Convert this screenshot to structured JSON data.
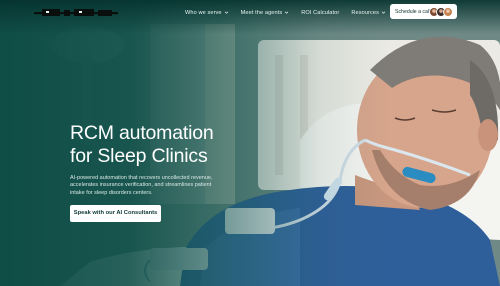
{
  "nav": {
    "links": [
      {
        "label": "Who we serve",
        "has_dropdown": true
      },
      {
        "label": "Meet the agents",
        "has_dropdown": true
      },
      {
        "label": "ROI Calculator",
        "has_dropdown": false
      },
      {
        "label": "Resources",
        "has_dropdown": true
      }
    ],
    "cta_label": "Schedule a call"
  },
  "hero": {
    "title_line1": "RCM automation",
    "title_line2": "for Sleep Clinics",
    "subtitle": "AI-powered automation that recovers uncollected revenue, accelerates insurance verification, and streamlines patient intake for sleep disorders centers.",
    "button_label": "Speak with our AI Consultants"
  },
  "colors": {
    "brand_teal": "#0b4a44",
    "cta_background": "#ffffff",
    "cta_text": "#0d2f2b"
  },
  "icons": [
    "chevron-down-icon",
    "avatar"
  ]
}
